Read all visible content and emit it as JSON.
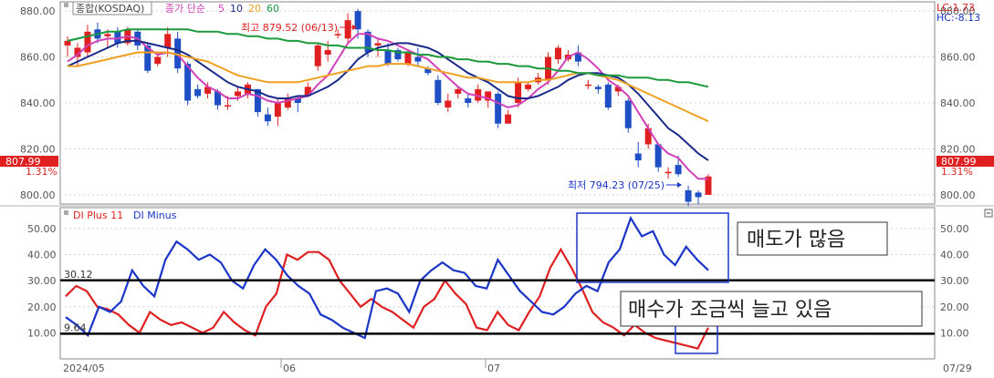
{
  "colors": {
    "up": "#e02020",
    "down": "#1f4fc4",
    "ma5": "#d040b8",
    "ma10": "#1a2a8a",
    "ma20": "#f0a020",
    "ma60": "#1a9a3a",
    "di_plus": "#e02020",
    "di_minus": "#1a35c8",
    "price_tag_bg": "#e02020",
    "lc_text": "#e02020",
    "hc_text": "#1a35c8"
  },
  "price_panel": {
    "legend": {
      "symbol": "종합(KOSDAQ)",
      "label": "종가 단순",
      "ma5": "5",
      "ma10": "10",
      "ma20": "20",
      "ma60": "60"
    },
    "lc": "LC:1.73",
    "hc": "HC:-8.13",
    "high_marker": "최고 879.52 (06/13)",
    "low_marker": "최저 794.23 (07/25)",
    "current_price": "807.99",
    "current_change": "1.31%",
    "y_ticks": [
      "880.00",
      "860.00",
      "840.00",
      "820.00",
      "800.00"
    ]
  },
  "indicator_panel": {
    "legend_plus": "DI Plus 11",
    "legend_minus": "DI Minus",
    "level_high": "30.12",
    "level_low": "9.64",
    "y_ticks": [
      "50.00",
      "40.00",
      "30.00",
      "20.00",
      "10.00"
    ],
    "annotation_selling": "매도가 많음",
    "annotation_buying": "매수가 조금씩 늘고 있음"
  },
  "x_axis": {
    "labels": [
      "2024/05",
      "06",
      "07",
      "07/29"
    ]
  },
  "chart_data": [
    {
      "type": "candlestick",
      "title": "종합(KOSDAQ)",
      "ylim": [
        796,
        884
      ],
      "candles": [
        {
          "o": 865,
          "h": 869,
          "l": 860,
          "c": 867
        },
        {
          "o": 860,
          "h": 866,
          "l": 856,
          "c": 864
        },
        {
          "o": 862,
          "h": 874,
          "l": 860,
          "c": 871
        },
        {
          "o": 872,
          "h": 875,
          "l": 866,
          "c": 868
        },
        {
          "o": 869,
          "h": 872,
          "l": 864,
          "c": 870
        },
        {
          "o": 871,
          "h": 873,
          "l": 864,
          "c": 866
        },
        {
          "o": 866,
          "h": 873,
          "l": 865,
          "c": 872
        },
        {
          "o": 871,
          "h": 872,
          "l": 863,
          "c": 865
        },
        {
          "o": 865,
          "h": 866,
          "l": 853,
          "c": 854
        },
        {
          "o": 857,
          "h": 861,
          "l": 856,
          "c": 860
        },
        {
          "o": 864,
          "h": 873,
          "l": 860,
          "c": 870
        },
        {
          "o": 868,
          "h": 871,
          "l": 853,
          "c": 855
        },
        {
          "o": 857,
          "h": 858,
          "l": 839,
          "c": 841
        },
        {
          "o": 846,
          "h": 848,
          "l": 842,
          "c": 843
        },
        {
          "o": 844,
          "h": 849,
          "l": 842,
          "c": 847
        },
        {
          "o": 845,
          "h": 846,
          "l": 837,
          "c": 839
        },
        {
          "o": 839,
          "h": 843,
          "l": 837,
          "c": 839
        },
        {
          "o": 843,
          "h": 847,
          "l": 841,
          "c": 845
        },
        {
          "o": 844,
          "h": 849,
          "l": 842,
          "c": 848
        },
        {
          "o": 846,
          "h": 846,
          "l": 834,
          "c": 836
        },
        {
          "o": 835,
          "h": 838,
          "l": 830,
          "c": 832
        },
        {
          "o": 834,
          "h": 842,
          "l": 830,
          "c": 840
        },
        {
          "o": 838,
          "h": 844,
          "l": 837,
          "c": 842
        },
        {
          "o": 842,
          "h": 843,
          "l": 836,
          "c": 840
        },
        {
          "o": 843,
          "h": 849,
          "l": 843,
          "c": 847
        },
        {
          "o": 856,
          "h": 866,
          "l": 854,
          "c": 865
        },
        {
          "o": 861,
          "h": 867,
          "l": 858,
          "c": 863
        },
        {
          "o": 870,
          "h": 872,
          "l": 868,
          "c": 870
        },
        {
          "o": 868,
          "h": 879,
          "l": 866,
          "c": 876
        },
        {
          "o": 880,
          "h": 881,
          "l": 868,
          "c": 872
        },
        {
          "o": 871,
          "h": 872,
          "l": 860,
          "c": 862
        },
        {
          "o": 865,
          "h": 868,
          "l": 860,
          "c": 866
        },
        {
          "o": 863,
          "h": 866,
          "l": 856,
          "c": 857
        },
        {
          "o": 863,
          "h": 864,
          "l": 858,
          "c": 859
        },
        {
          "o": 857,
          "h": 863,
          "l": 856,
          "c": 862
        },
        {
          "o": 860,
          "h": 864,
          "l": 856,
          "c": 858
        },
        {
          "o": 855,
          "h": 856,
          "l": 852,
          "c": 853
        },
        {
          "o": 850,
          "h": 852,
          "l": 839,
          "c": 840
        },
        {
          "o": 838,
          "h": 844,
          "l": 836,
          "c": 841
        },
        {
          "o": 844,
          "h": 847,
          "l": 842,
          "c": 846
        },
        {
          "o": 842,
          "h": 844,
          "l": 838,
          "c": 840
        },
        {
          "o": 841,
          "h": 848,
          "l": 840,
          "c": 846
        },
        {
          "o": 841,
          "h": 843,
          "l": 838,
          "c": 845
        },
        {
          "o": 844,
          "h": 845,
          "l": 829,
          "c": 831
        },
        {
          "o": 831,
          "h": 837,
          "l": 831,
          "c": 835
        },
        {
          "o": 840,
          "h": 851,
          "l": 838,
          "c": 849
        },
        {
          "o": 846,
          "h": 849,
          "l": 845,
          "c": 848
        },
        {
          "o": 849,
          "h": 853,
          "l": 848,
          "c": 851
        },
        {
          "o": 850,
          "h": 862,
          "l": 848,
          "c": 860
        },
        {
          "o": 859,
          "h": 865,
          "l": 857,
          "c": 864
        },
        {
          "o": 859,
          "h": 863,
          "l": 858,
          "c": 861
        },
        {
          "o": 862,
          "h": 865,
          "l": 856,
          "c": 858
        },
        {
          "o": 848,
          "h": 850,
          "l": 846,
          "c": 848
        },
        {
          "o": 847,
          "h": 848,
          "l": 844,
          "c": 846
        },
        {
          "o": 848,
          "h": 849,
          "l": 837,
          "c": 838
        },
        {
          "o": 845,
          "h": 848,
          "l": 843,
          "c": 847
        },
        {
          "o": 841,
          "h": 842,
          "l": 827,
          "c": 829
        },
        {
          "o": 818,
          "h": 823,
          "l": 812,
          "c": 815
        },
        {
          "o": 822,
          "h": 831,
          "l": 820,
          "c": 829
        },
        {
          "o": 822,
          "h": 822,
          "l": 810,
          "c": 812
        },
        {
          "o": 810,
          "h": 812,
          "l": 807,
          "c": 810
        },
        {
          "o": 813,
          "h": 817,
          "l": 808,
          "c": 809
        },
        {
          "o": 802,
          "h": 804,
          "l": 795,
          "c": 797
        },
        {
          "o": 801,
          "h": 802,
          "l": 796,
          "c": 799
        },
        {
          "o": 800,
          "h": 809,
          "l": 800,
          "c": 808
        }
      ],
      "series": [
        {
          "name": "5",
          "values": [
            858,
            861,
            865,
            867,
            868,
            868,
            869,
            868,
            864,
            861,
            862,
            861,
            856,
            851,
            847,
            845,
            842,
            842,
            844,
            843,
            841,
            840,
            841,
            842,
            843,
            848,
            852,
            859,
            866,
            870,
            870,
            868,
            867,
            865,
            863,
            861,
            859,
            855,
            851,
            847,
            844,
            843,
            842,
            840,
            838,
            839,
            842,
            846,
            849,
            854,
            860,
            862,
            859,
            855,
            850,
            847,
            843,
            836,
            829,
            822,
            818,
            816,
            811,
            807,
            807
          ]
        },
        {
          "name": "10",
          "values": [
            856,
            858,
            860,
            862,
            864,
            866,
            867,
            867,
            866,
            865,
            864,
            863,
            861,
            858,
            855,
            852,
            849,
            847,
            846,
            845,
            843,
            842,
            842,
            843,
            843,
            845,
            847,
            850,
            854,
            859,
            862,
            864,
            865,
            866,
            866,
            865,
            864,
            862,
            859,
            856,
            853,
            851,
            849,
            846,
            843,
            842,
            842,
            843,
            845,
            847,
            850,
            852,
            853,
            853,
            852,
            851,
            848,
            844,
            839,
            834,
            829,
            826,
            822,
            818,
            815
          ]
        },
        {
          "name": "20",
          "values": [
            856,
            856,
            857,
            858,
            859,
            860,
            861,
            862,
            862,
            862,
            862,
            861,
            860,
            859,
            858,
            856,
            854,
            852,
            851,
            850,
            849,
            849,
            849,
            849,
            850,
            851,
            852,
            853,
            854,
            855,
            856,
            856,
            857,
            857,
            857,
            856,
            855,
            854,
            853,
            852,
            851,
            851,
            850,
            849,
            849,
            849,
            849,
            850,
            850,
            851,
            852,
            853,
            853,
            852,
            851,
            850,
            848,
            846,
            844,
            842,
            840,
            838,
            836,
            834,
            832
          ]
        },
        {
          "name": "60",
          "values": [
            867,
            868,
            869,
            870,
            871,
            871,
            872,
            872,
            872,
            872,
            872,
            872,
            872,
            871,
            871,
            871,
            870,
            870,
            869,
            869,
            868,
            868,
            867,
            867,
            866,
            866,
            865,
            865,
            864,
            864,
            864,
            863,
            863,
            862,
            862,
            861,
            861,
            860,
            860,
            859,
            859,
            858,
            858,
            857,
            857,
            856,
            856,
            855,
            855,
            854,
            854,
            853,
            853,
            852,
            852,
            852,
            851,
            851,
            851,
            850,
            850,
            849,
            849,
            848,
            847
          ]
        }
      ]
    },
    {
      "type": "line",
      "ylim": [
        0,
        58
      ],
      "x": [
        "2024/05",
        "06",
        "07",
        "07/29"
      ],
      "series": [
        {
          "name": "DI Plus 11",
          "values": [
            24,
            28,
            26,
            20,
            19,
            17,
            13,
            10,
            18,
            15,
            13,
            14,
            12,
            10,
            12,
            18,
            14,
            11,
            9,
            20,
            25,
            40,
            38,
            41,
            41,
            38,
            30,
            25,
            20,
            23,
            20,
            18,
            15,
            12,
            20,
            23,
            30,
            25,
            21,
            12,
            11,
            18,
            13,
            11,
            18,
            24,
            35,
            42,
            35,
            27,
            18,
            14,
            12,
            9,
            13,
            10,
            8,
            7,
            6,
            5,
            4,
            12
          ]
        },
        {
          "name": "DI Minus",
          "values": [
            16,
            13,
            9,
            20,
            18,
            22,
            34,
            28,
            24,
            38,
            45,
            42,
            38,
            40,
            37,
            30,
            27,
            36,
            42,
            38,
            32,
            28,
            25,
            17,
            15,
            12,
            10,
            8,
            26,
            27,
            25,
            18,
            30,
            34,
            37,
            34,
            33,
            28,
            27,
            38,
            32,
            26,
            22,
            18,
            17,
            20,
            25,
            28,
            26,
            37,
            42,
            54,
            47,
            49,
            40,
            36,
            43,
            38,
            34
          ]
        }
      ]
    }
  ]
}
